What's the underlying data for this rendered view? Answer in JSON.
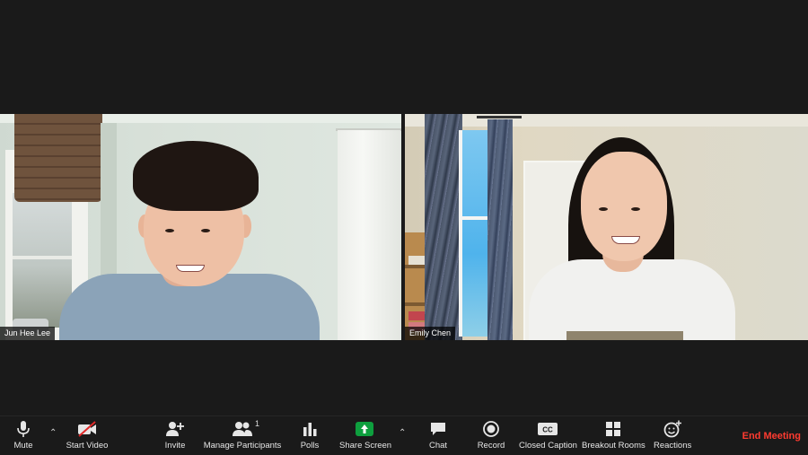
{
  "participants": [
    {
      "name": "Jun Hee Lee"
    },
    {
      "name": "Emily Chen"
    }
  ],
  "toolbar": {
    "mute": "Mute",
    "start_video": "Start Video",
    "invite": "Invite",
    "manage_participants": "Manage Participants",
    "participant_count": "1",
    "polls": "Polls",
    "share_screen": "Share Screen",
    "chat": "Chat",
    "record": "Record",
    "closed_caption": "Closed Caption",
    "cc_glyph": "CC",
    "breakout_rooms": "Breakout Rooms",
    "reactions": "Reactions",
    "end_meeting": "End Meeting"
  },
  "colors": {
    "share_green": "#0e9f3e",
    "end_red": "#ff3b30",
    "background": "#1a1a1a"
  },
  "icons": [
    "microphone-icon",
    "caret-up-icon",
    "video-off-icon",
    "add-user-icon",
    "participants-icon",
    "polls-icon",
    "share-screen-icon",
    "chat-icon",
    "record-icon",
    "closed-caption-icon",
    "breakout-rooms-icon",
    "reactions-icon"
  ]
}
